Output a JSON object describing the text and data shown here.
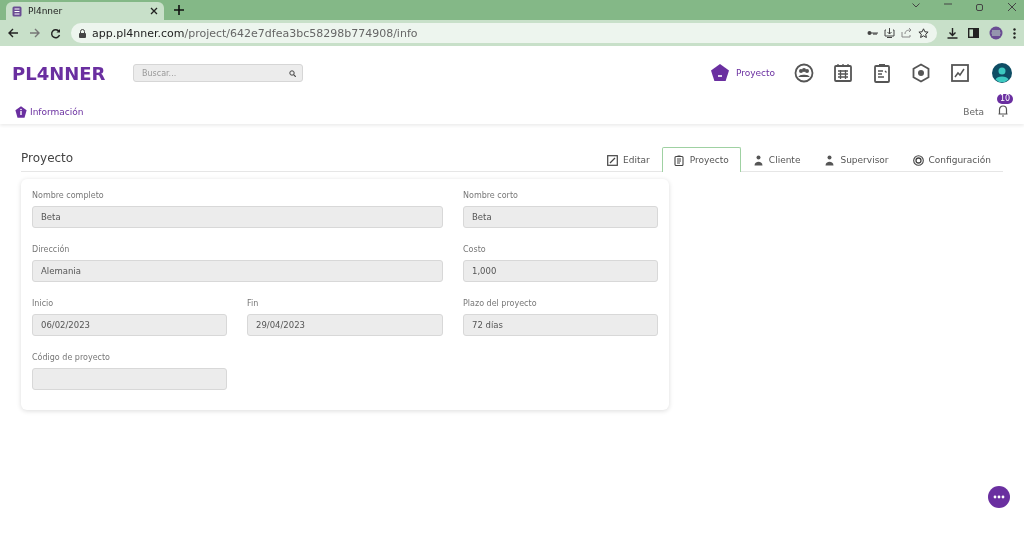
{
  "browser": {
    "tab_title": "Pl4nner",
    "url_host": "app.pl4nner.com",
    "url_path": "/project/642e7dfea3bc58298b774908/info"
  },
  "header": {
    "logo": "PL4NNER",
    "search": {
      "placeholder": "Buscar..."
    },
    "nav": [
      {
        "kind": "project",
        "label": "Proyecto",
        "selected": true
      },
      {
        "kind": "team",
        "selected": false
      },
      {
        "kind": "calendar",
        "selected": false
      },
      {
        "kind": "clipboard",
        "selected": false
      },
      {
        "kind": "hexagon",
        "selected": false
      },
      {
        "kind": "chart",
        "selected": false
      }
    ]
  },
  "subheader": {
    "section": "Información",
    "project": "Beta",
    "notifications": "10"
  },
  "page": {
    "title": "Proyecto",
    "tabs": [
      {
        "kind": "edit",
        "label": "Editar",
        "selected": false
      },
      {
        "kind": "doc",
        "label": "Proyecto",
        "selected": true
      },
      {
        "kind": "person",
        "label": "Cliente",
        "selected": false
      },
      {
        "kind": "person",
        "label": "Supervisor",
        "selected": false
      },
      {
        "kind": "gear",
        "label": "Configuración",
        "selected": false
      }
    ],
    "rows": [
      [
        {
          "label": "Nombre completo",
          "value": "Beta",
          "wide": true
        },
        {
          "label": "Nombre corto",
          "value": "Beta",
          "wide": false
        }
      ],
      [
        {
          "label": "Dirección",
          "value": "Alemania",
          "wide": true
        },
        {
          "label": "Costo",
          "value": "1,000",
          "wide": false
        }
      ],
      [
        {
          "label": "Inicio",
          "value": "06/02/2023",
          "wide": false
        },
        {
          "label": "Fin",
          "value": "29/04/2023",
          "wide": false
        },
        {
          "label": "Plazo del proyecto",
          "value": "72 días",
          "wide": false
        }
      ],
      [
        {
          "label": "Código de proyecto",
          "wide": false
        }
      ]
    ]
  }
}
